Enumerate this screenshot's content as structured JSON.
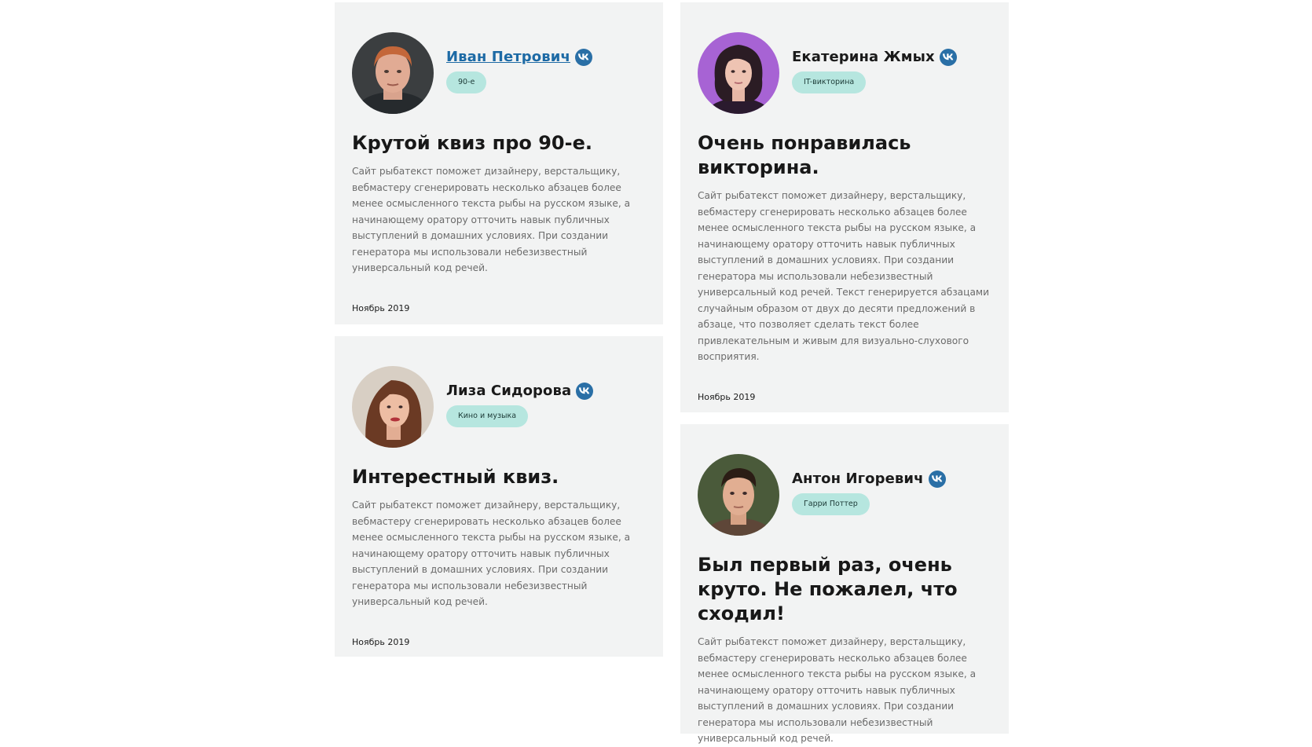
{
  "reviews": [
    {
      "name": "Иван Петрович",
      "tag": "90-е",
      "title": "Крутой квиз про 90-е.",
      "text": "Сайт рыбатекст поможет дизайнеру, верстальщику, вебмастеру сгенерировать несколько абзацев более менее осмысленного текста рыбы на русском языке, а начинающему оратору отточить навык публичных выступлений в домашних условиях. При создании генератора мы использовали небезизвестный универсальный код речей.",
      "date": "Ноябрь 2019"
    },
    {
      "name": "Екатерина Жмых",
      "tag": "IT-викторина",
      "title": "Очень понравилась викторина.",
      "text": "Сайт рыбатекст поможет дизайнеру, верстальщику, вебмастеру сгенерировать несколько абзацев более менее осмысленного текста рыбы на русском языке, а начинающему оратору отточить навык публичных выступлений в домашних условиях. При создании генератора мы использовали небезизвестный универсальный код речей. Текст генерируется абзацами случайным образом от двух до десяти предложений в абзаце, что позволяет сделать текст более привлекательным и живым для визуально-слухового восприятия.",
      "date": "Ноябрь 2019"
    },
    {
      "name": "Лиза Сидорова",
      "tag": "Кино и музыка",
      "title": "Интерестный квиз.",
      "text": "Сайт рыбатекст поможет дизайнеру, верстальщику, вебмастеру сгенерировать несколько абзацев более менее осмысленного текста рыбы на русском языке, а начинающему оратору отточить навык публичных выступлений в домашних условиях. При создании генератора мы использовали небезизвестный универсальный код речей.",
      "date": "Ноябрь 2019"
    },
    {
      "name": "Антон Игоревич",
      "tag": "Гарри Поттер",
      "title": "Был первый раз, очень круто. Не пожалел, что сходил!",
      "text": "Сайт рыбатекст поможет дизайнеру, верстальщику, вебмастеру сгенерировать несколько абзацев более менее осмысленного текста рыбы на русском языке, а начинающему оратору отточить навык публичных выступлений в домашних условиях. При создании генератора мы использовали небезизвестный универсальный код речей."
    }
  ],
  "colors": {
    "card_bg": "#f2f3f3",
    "tag_bg": "#b6e6df",
    "vk_icon": "#2a6fa6",
    "link": "#1d6aa5"
  },
  "icons": [
    "vk-icon",
    "avatar-photo"
  ]
}
